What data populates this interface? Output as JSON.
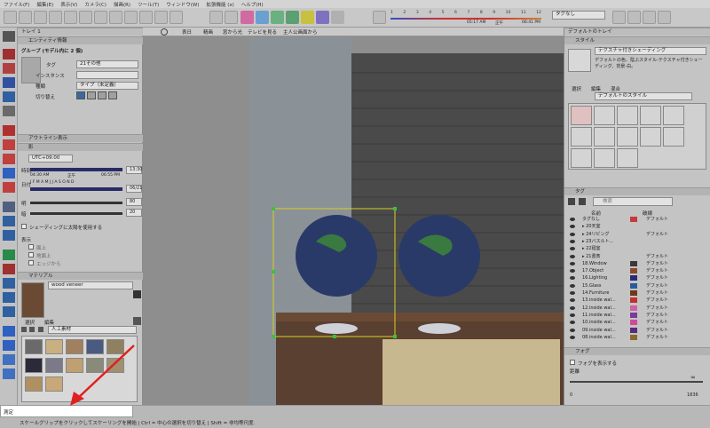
{
  "menu": {
    "items": [
      "ファイル(F)",
      "編集(E)",
      "表示(V)",
      "カメラ(C)",
      "描画(R)",
      "ツール(T)",
      "ウィンドウ(W)",
      "拡張機能 (x)",
      "ヘルプ(H)"
    ]
  },
  "toolbar": {
    "timeline_labels": [
      "1",
      "2",
      "3",
      "4",
      "5",
      "6",
      "7",
      "8",
      "9",
      "10",
      "11",
      "12"
    ],
    "time_start": "05:17 AM",
    "time_mid": "正午",
    "time_end": "06:41 PM",
    "tag_select": "タグなし"
  },
  "entity": {
    "header": "エンティティ情報",
    "title": "グループ (モデル内に 2 個)",
    "tag_label": "タグ",
    "tag_value": "21その他",
    "instance_label": "インスタンス",
    "type_label": "種類",
    "type_value": "タイプ（未定義）",
    "toggle_label": "切り替え"
  },
  "outline": {
    "header": "アウトライン表示"
  },
  "shadow": {
    "header": "影",
    "tz": "UTC+09:00",
    "time_label": "時刻",
    "time_start": "04:30 AM",
    "time_noon": "正午",
    "time_end": "06:55 PM",
    "time_value": "13:30",
    "date_label": "日付",
    "date_months": "J F M A M J J A S O N D",
    "date_value": "06/21",
    "light_label": "明",
    "light_value": "80",
    "dark_label": "暗",
    "dark_value": "20",
    "use_sun": "シェーディングに太陽を使用する",
    "display_label": "表示",
    "on_faces": "面上",
    "on_ground": "地面上",
    "from_edges": "エッジから"
  },
  "material": {
    "header": "マテリアル",
    "name": "wood veneer",
    "tab_select": "選択",
    "tab_edit": "編集",
    "library": "人工素材"
  },
  "scenes": {
    "tabs": [
      "表日",
      "精画",
      "窓から光",
      "テレビを見る",
      "主人公画面から"
    ]
  },
  "styles": {
    "tray_title": "デフォルトのトレイ",
    "header": "スタイル",
    "name": "テクスチャ付きシェーディング",
    "desc": "デフォルトの色、陰ぶスタイル-テクスチャ付きシェーディング、背景-白。",
    "tab_select": "選択",
    "tab_edit": "編集",
    "tab_mix": "混合",
    "collection": "デフォルトのスタイル"
  },
  "tags": {
    "header": "タグ",
    "search_placeholder": "検索",
    "col_name": "名前",
    "col_dash": "破線",
    "rows": [
      {
        "name": "タグなし",
        "dash": "デフォルト",
        "color": "#c83a3a"
      },
      {
        "name": "▸ 20天室",
        "dash": "",
        "color": ""
      },
      {
        "name": "▸ 24リビング",
        "dash": "デフォルト",
        "color": ""
      },
      {
        "name": "▸ 23バスルト...",
        "dash": "",
        "color": ""
      },
      {
        "name": "▸ 22寝室",
        "dash": "",
        "color": ""
      },
      {
        "name": "▸ 21書斎",
        "dash": "デフォルト",
        "color": ""
      },
      {
        "name": "18.Window",
        "dash": "デフォルト",
        "color": "#3a3a3a"
      },
      {
        "name": "17.Object",
        "dash": "デフォルト",
        "color": "#8a4a2a"
      },
      {
        "name": "16.Lighting",
        "dash": "デフォルト",
        "color": "#2a2a7a"
      },
      {
        "name": "15.Glass",
        "dash": "デフォルト",
        "color": "#2a5a9a"
      },
      {
        "name": "14.Furniture",
        "dash": "デフォルト",
        "color": "#6a3a1a"
      },
      {
        "name": "13.inside wal...",
        "dash": "デフォルト",
        "color": "#c03030"
      },
      {
        "name": "12.inside wal...",
        "dash": "デフォルト",
        "color": "#d060a0"
      },
      {
        "name": "11.inside wal...",
        "dash": "デフォルト",
        "color": "#7a3a9a"
      },
      {
        "name": "10.inside wal...",
        "dash": "デフォルト",
        "color": "#d04a9a"
      },
      {
        "name": "09.inside wal...",
        "dash": "デフォルト",
        "color": "#5a2a7a"
      },
      {
        "name": "08.inside wal...",
        "dash": "デフォルト",
        "color": "#8a6a2a"
      }
    ]
  },
  "fog": {
    "header": "フォグ",
    "show": "フォグを表示する",
    "distance": "距離",
    "min": "0",
    "max": "1836",
    "inf": "∞"
  },
  "status": {
    "measure_label": "測定",
    "hint": "スケールグリップをクリックしてスケーリングを開始 | Ctrl = 中心の選択を切り替え | Shift = 非均等尺度."
  }
}
